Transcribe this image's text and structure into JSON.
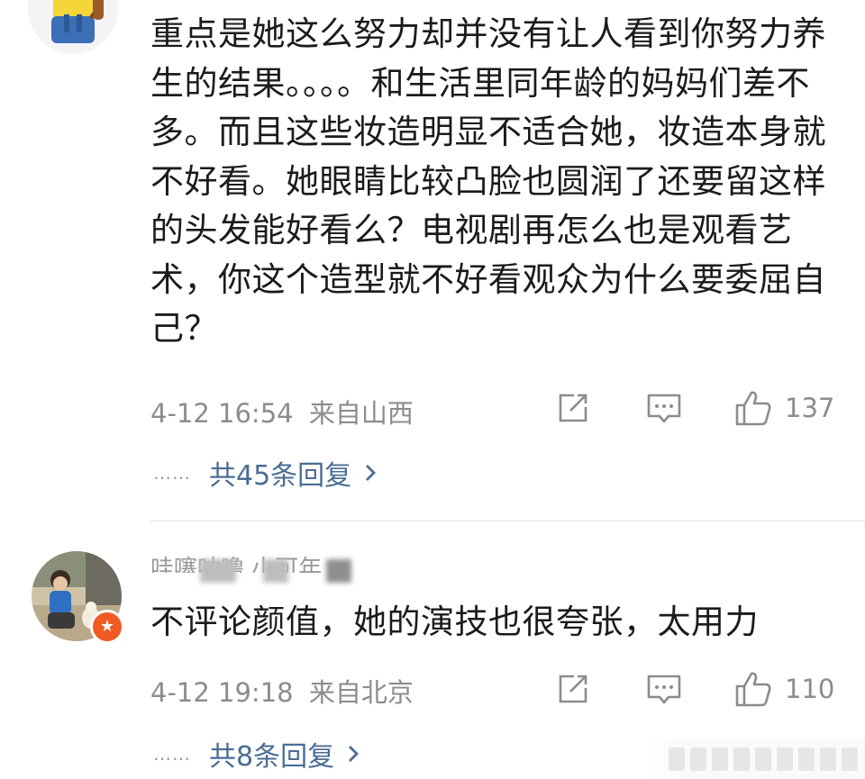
{
  "comments": [
    {
      "text": "重点是她这么努力却并没有让人看到你努力养生的结果。。。。和生活里同年龄的妈妈们差不多。而且这些妆造明显不适合她，妆造本身就不好看。她眼睛比较凸脸也圆润了还要留这样的头发能好看么？电视剧再怎么也是观看艺术，你这个造型就不好看观众为什么要委屈自己？",
      "date": "4-12 16:54",
      "location": "来自山西",
      "likes": "137",
      "replies": "共45条回复",
      "avatar_icon": "minion-avatar"
    },
    {
      "username": "哇噻咕噜 小可年",
      "text": "不评论颜值，她的演技也很夸张，太用力",
      "date": "4-12 19:18",
      "location": "来自北京",
      "likes": "110",
      "replies": "共8条回复",
      "avatar_icon": "user-photo-avatar",
      "badge_icon": "star-badge-icon"
    }
  ],
  "icons": {
    "share": "share-icon",
    "comment": "comment-icon",
    "like": "thumbs-up-icon",
    "chevron": "chevron-right-icon"
  },
  "dots_text": "……",
  "colors": {
    "link": "#4a6d93",
    "meta": "#8c8c8c",
    "badge": "#ef5b23"
  }
}
